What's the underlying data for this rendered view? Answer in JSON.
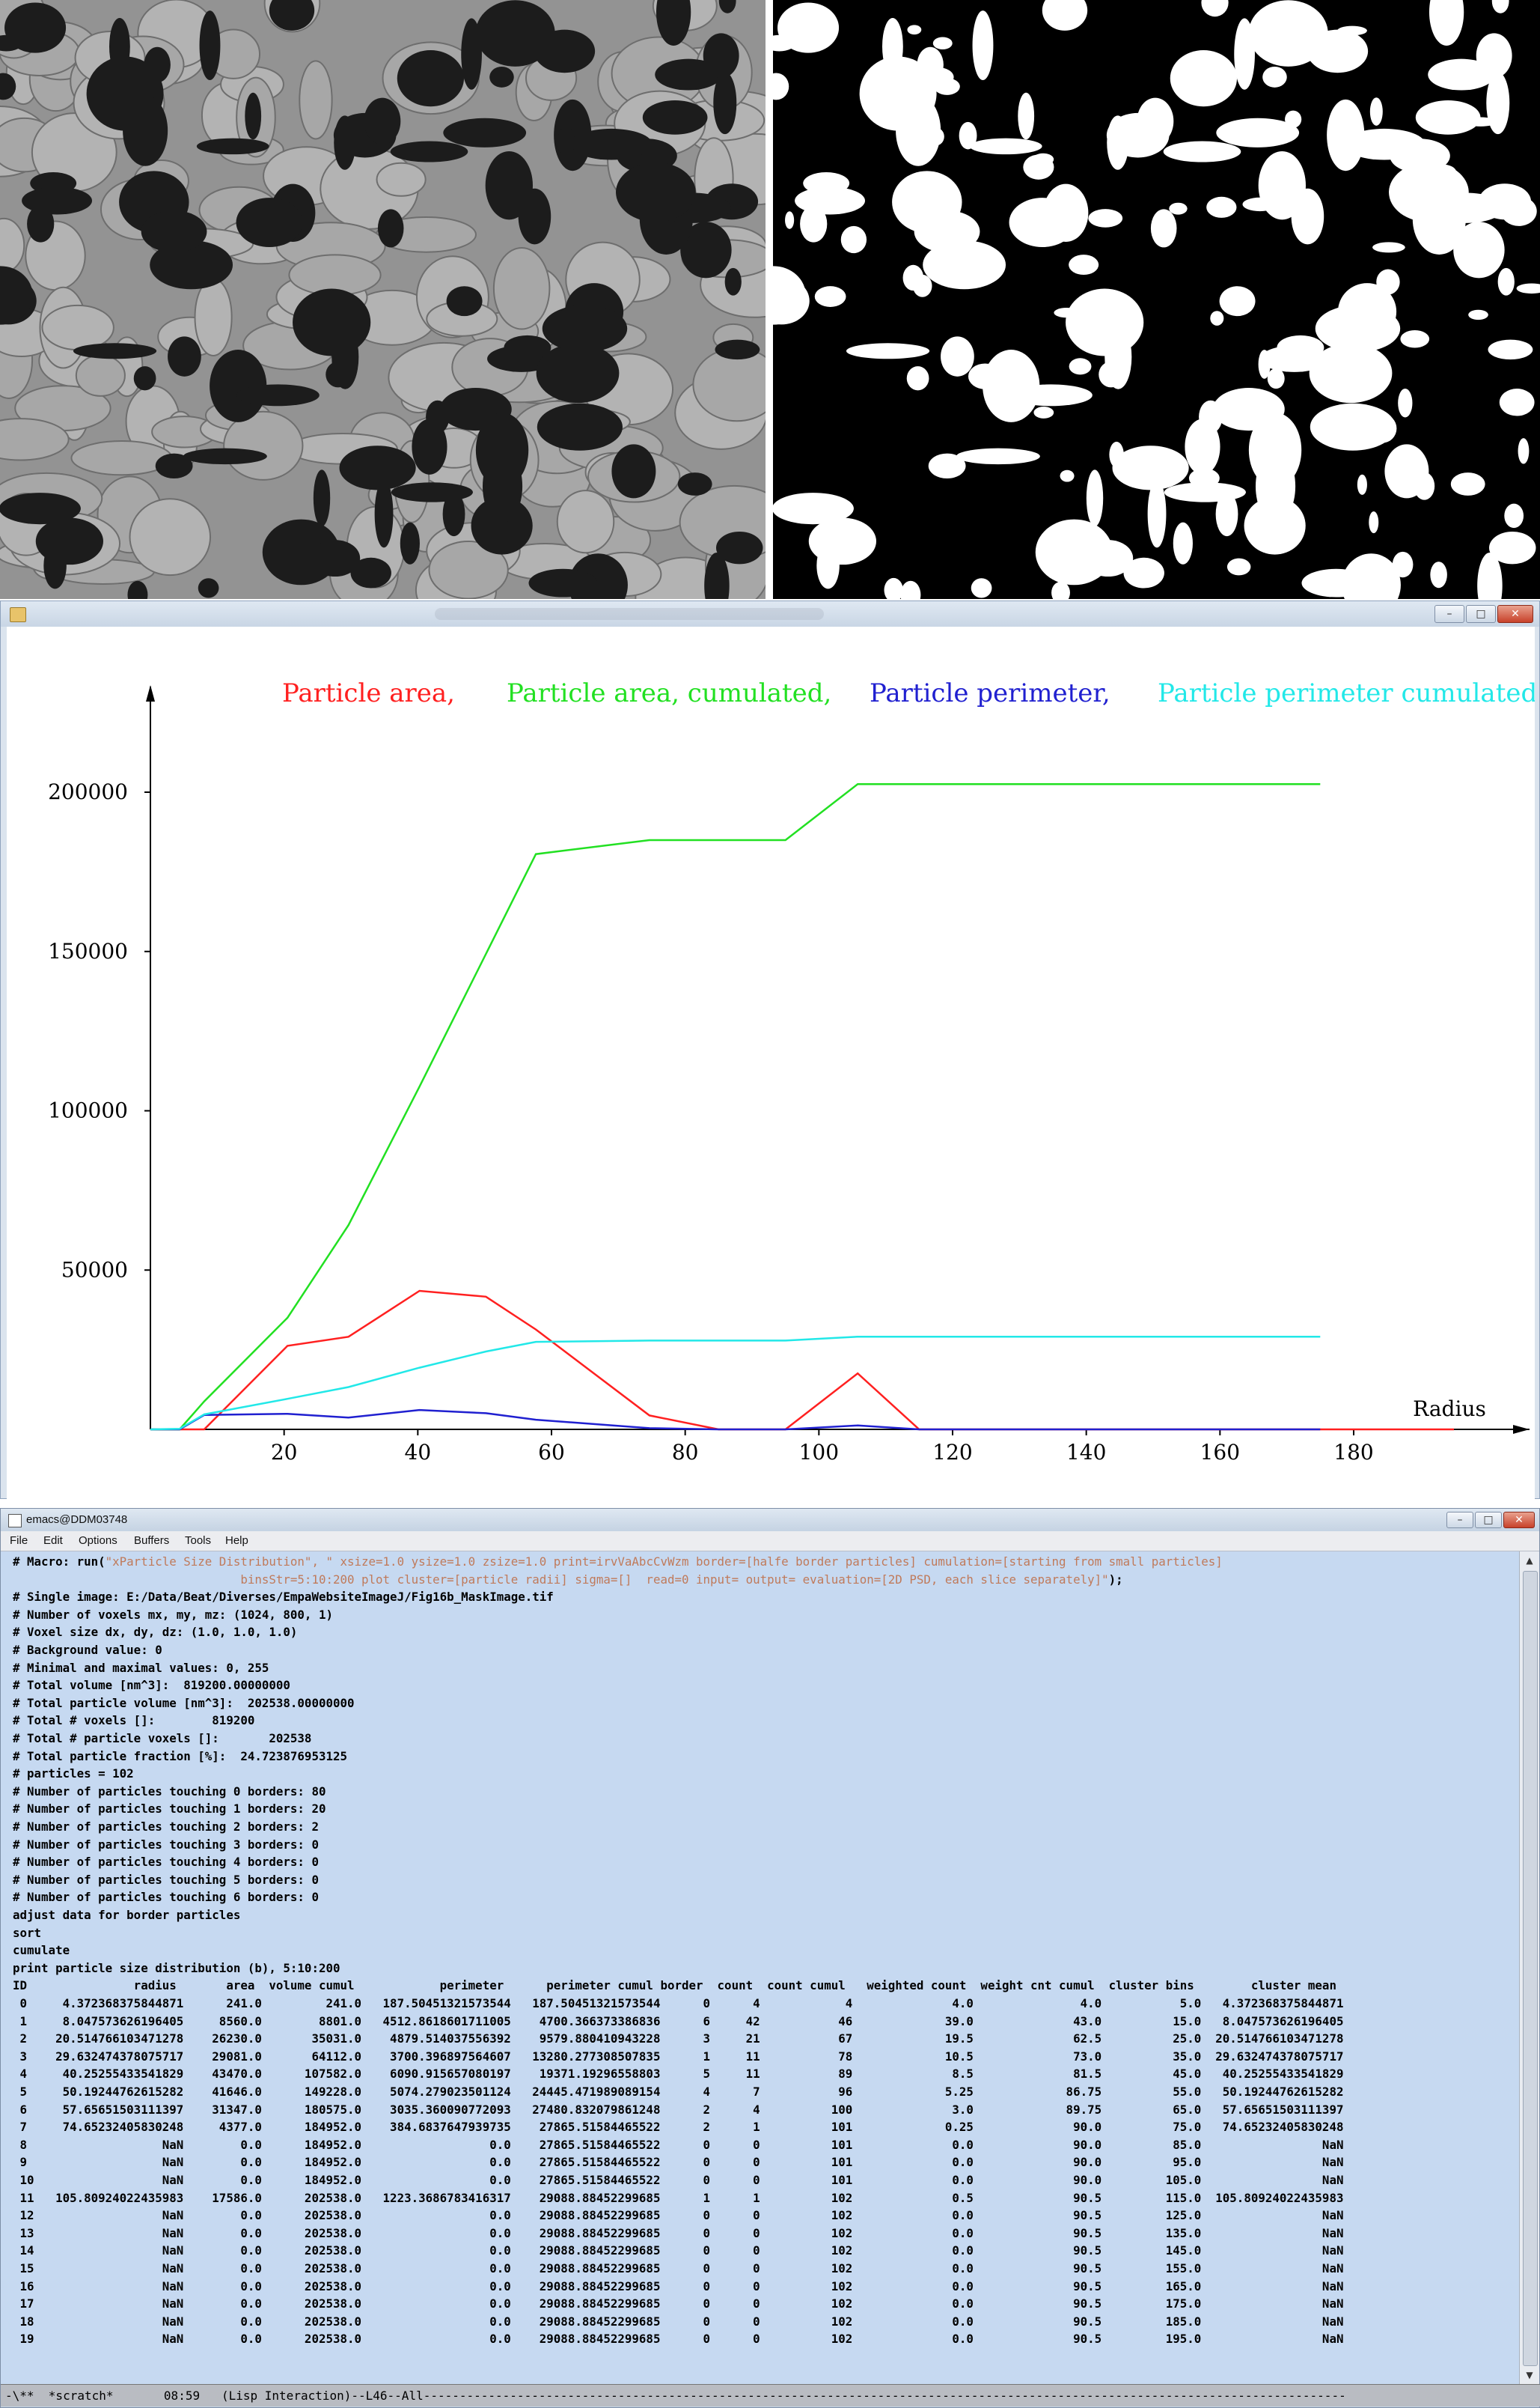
{
  "plot_window": {
    "title": "",
    "buttons": [
      "–",
      "□",
      "✕"
    ]
  },
  "chart_data": {
    "type": "line",
    "title": "",
    "xlabel": "Radius",
    "ylabel": "",
    "xlim": [
      0,
      190
    ],
    "ylim": [
      0,
      220000
    ],
    "x_ticks": [
      20,
      40,
      60,
      80,
      100,
      120,
      140,
      160,
      180
    ],
    "y_ticks": [
      50000,
      100000,
      150000,
      200000
    ],
    "legend_position": "top",
    "series": [
      {
        "name": "Particle area,",
        "color": "#ff2020",
        "x": [
          0,
          4.37,
          8.05,
          20.51,
          29.63,
          40.25,
          50.19,
          57.66,
          74.65,
          85,
          95,
          105.81,
          115,
          125,
          135,
          145,
          155,
          165,
          175,
          185,
          195
        ],
        "y": [
          0,
          0,
          0,
          26230,
          29081,
          43470,
          41646,
          31347,
          4377,
          0,
          0,
          17586,
          0,
          0,
          0,
          0,
          0,
          0,
          0,
          0,
          0
        ]
      },
      {
        "name": "Particle area, cumulated,",
        "color": "#22e022",
        "x": [
          0,
          4.37,
          8.05,
          20.51,
          29.63,
          40.25,
          50.19,
          57.66,
          74.65,
          85,
          95,
          105.81,
          115,
          125,
          135,
          145,
          155,
          165,
          175
        ],
        "y": [
          0,
          0,
          8801,
          35031,
          64112,
          107582,
          149228,
          180575,
          184952,
          184952,
          184952,
          202538,
          202538,
          202538,
          202538,
          202538,
          202538,
          202538,
          202538
        ]
      },
      {
        "name": "Particle perimeter,",
        "color": "#2020d0",
        "x": [
          0,
          4.37,
          8.05,
          20.51,
          29.63,
          40.25,
          50.19,
          57.66,
          74.65,
          85,
          95,
          105.81,
          115,
          125,
          135,
          145,
          155,
          165,
          175
        ],
        "y": [
          0,
          0,
          4512,
          4880,
          3700,
          6091,
          5074,
          3035,
          385,
          0,
          0,
          1223,
          0,
          0,
          0,
          0,
          0,
          0,
          0
        ]
      },
      {
        "name": "Particle perimeter cumulated",
        "color": "#22e8e8",
        "x": [
          0,
          4.37,
          8.05,
          20.51,
          29.63,
          40.25,
          50.19,
          57.66,
          74.65,
          85,
          95,
          105.81,
          115,
          125,
          135,
          145,
          155,
          165,
          175
        ],
        "y": [
          0,
          187.5,
          4700,
          9580,
          13280,
          19371,
          24445,
          27480,
          27866,
          27866,
          27866,
          29089,
          29089,
          29089,
          29089,
          29089,
          29089,
          29089,
          29089
        ]
      }
    ]
  },
  "emacs": {
    "title": "emacs@DDM03748",
    "menu": [
      "File",
      "Edit",
      "Options",
      "Buffers",
      "Tools",
      "Help"
    ],
    "macro_prefix": "# Macro: run(",
    "macro_string_1": "\"xParticle Size Distribution\", \" xsize=1.0 ysize=1.0 zsize=1.0 print=irvVaAbcCvWzm border=[halfe border particles] cumulation=[starting from small particles]",
    "macro_string_2": "                                binsStr=5:10:200 plot cluster=[particle radii] sigma=[]  read=0 input= output= evaluation=[2D PSD, each slice separately]\"",
    "macro_suffix": ");",
    "lines": [
      "# Single image: E:/Data/Beat/Diverses/EmpaWebsiteImageJ/Fig16b_MaskImage.tif",
      "# Number of voxels mx, my, mz: (1024, 800, 1)",
      "# Voxel size dx, dy, dz: (1.0, 1.0, 1.0)",
      "# Background value: 0",
      "# Minimal and maximal values: 0, 255",
      "# Total volume [nm^3]:  819200.00000000",
      "# Total particle volume [nm^3]:  202538.00000000",
      "# Total # voxels []:        819200",
      "# Total # particle voxels []:       202538",
      "# Total particle fraction [%]:  24.723876953125",
      "# particles = 102",
      "# Number of particles touching 0 borders: 80",
      "# Number of particles touching 1 borders: 20",
      "# Number of particles touching 2 borders: 2",
      "# Number of particles touching 3 borders: 0",
      "# Number of particles touching 4 borders: 0",
      "# Number of particles touching 5 borders: 0",
      "# Number of particles touching 6 borders: 0",
      "adjust data for border particles",
      "sort",
      "cumulate",
      "print particle size distribution (b), 5:10:200"
    ],
    "table_header": [
      "ID",
      "radius",
      "area",
      "volume cumul",
      "perimeter",
      "perimeter cumul",
      "border",
      "count",
      "count cumul",
      "weighted count",
      "weight cnt cumul",
      "cluster bins",
      "cluster mean"
    ],
    "table_rows": [
      [
        "0",
        "4.372368375844871",
        "241.0",
        "241.0",
        "187.50451321573544",
        "187.50451321573544",
        "0",
        "4",
        "4",
        "4.0",
        "4.0",
        "5.0",
        "4.372368375844871"
      ],
      [
        "1",
        "8.047573626196405",
        "8560.0",
        "8801.0",
        "4512.8618601711005",
        "4700.366373386836",
        "6",
        "42",
        "46",
        "39.0",
        "43.0",
        "15.0",
        "8.047573626196405"
      ],
      [
        "2",
        "20.514766103471278",
        "26230.0",
        "35031.0",
        "4879.514037556392",
        "9579.880410943228",
        "3",
        "21",
        "67",
        "19.5",
        "62.5",
        "25.0",
        "20.514766103471278"
      ],
      [
        "3",
        "29.632474378075717",
        "29081.0",
        "64112.0",
        "3700.396897564607",
        "13280.277308507835",
        "1",
        "11",
        "78",
        "10.5",
        "73.0",
        "35.0",
        "29.632474378075717"
      ],
      [
        "4",
        "40.25255433541829",
        "43470.0",
        "107582.0",
        "6090.915657080197",
        "19371.19296558803",
        "5",
        "11",
        "89",
        "8.5",
        "81.5",
        "45.0",
        "40.25255433541829"
      ],
      [
        "5",
        "50.19244762615282",
        "41646.0",
        "149228.0",
        "5074.279023501124",
        "24445.471989089154",
        "4",
        "7",
        "96",
        "5.25",
        "86.75",
        "55.0",
        "50.19244762615282"
      ],
      [
        "6",
        "57.65651503111397",
        "31347.0",
        "180575.0",
        "3035.360090772093",
        "27480.832079861248",
        "2",
        "4",
        "100",
        "3.0",
        "89.75",
        "65.0",
        "57.65651503111397"
      ],
      [
        "7",
        "74.65232405830248",
        "4377.0",
        "184952.0",
        "384.6837647939735",
        "27865.51584465522",
        "2",
        "1",
        "101",
        "0.25",
        "90.0",
        "75.0",
        "74.65232405830248"
      ],
      [
        "8",
        "NaN",
        "0.0",
        "184952.0",
        "0.0",
        "27865.51584465522",
        "0",
        "0",
        "101",
        "0.0",
        "90.0",
        "85.0",
        "NaN"
      ],
      [
        "9",
        "NaN",
        "0.0",
        "184952.0",
        "0.0",
        "27865.51584465522",
        "0",
        "0",
        "101",
        "0.0",
        "90.0",
        "95.0",
        "NaN"
      ],
      [
        "10",
        "NaN",
        "0.0",
        "184952.0",
        "0.0",
        "27865.51584465522",
        "0",
        "0",
        "101",
        "0.0",
        "90.0",
        "105.0",
        "NaN"
      ],
      [
        "11",
        "105.80924022435983",
        "17586.0",
        "202538.0",
        "1223.3686783416317",
        "29088.88452299685",
        "1",
        "1",
        "102",
        "0.5",
        "90.5",
        "115.0",
        "105.80924022435983"
      ],
      [
        "12",
        "NaN",
        "0.0",
        "202538.0",
        "0.0",
        "29088.88452299685",
        "0",
        "0",
        "102",
        "0.0",
        "90.5",
        "125.0",
        "NaN"
      ],
      [
        "13",
        "NaN",
        "0.0",
        "202538.0",
        "0.0",
        "29088.88452299685",
        "0",
        "0",
        "102",
        "0.0",
        "90.5",
        "135.0",
        "NaN"
      ],
      [
        "14",
        "NaN",
        "0.0",
        "202538.0",
        "0.0",
        "29088.88452299685",
        "0",
        "0",
        "102",
        "0.0",
        "90.5",
        "145.0",
        "NaN"
      ],
      [
        "15",
        "NaN",
        "0.0",
        "202538.0",
        "0.0",
        "29088.88452299685",
        "0",
        "0",
        "102",
        "0.0",
        "90.5",
        "155.0",
        "NaN"
      ],
      [
        "16",
        "NaN",
        "0.0",
        "202538.0",
        "0.0",
        "29088.88452299685",
        "0",
        "0",
        "102",
        "0.0",
        "90.5",
        "165.0",
        "NaN"
      ],
      [
        "17",
        "NaN",
        "0.0",
        "202538.0",
        "0.0",
        "29088.88452299685",
        "0",
        "0",
        "102",
        "0.0",
        "90.5",
        "175.0",
        "NaN"
      ],
      [
        "18",
        "NaN",
        "0.0",
        "202538.0",
        "0.0",
        "29088.88452299685",
        "0",
        "0",
        "102",
        "0.0",
        "90.5",
        "185.0",
        "NaN"
      ],
      [
        "19",
        "NaN",
        "0.0",
        "202538.0",
        "0.0",
        "29088.88452299685",
        "0",
        "0",
        "102",
        "0.0",
        "90.5",
        "195.0",
        "NaN"
      ]
    ],
    "modeline": "-\\**  *scratch*       08:59   (Lisp Interaction)--L46--All--------------------------------------------------------------------------------------------------------------------------------"
  }
}
